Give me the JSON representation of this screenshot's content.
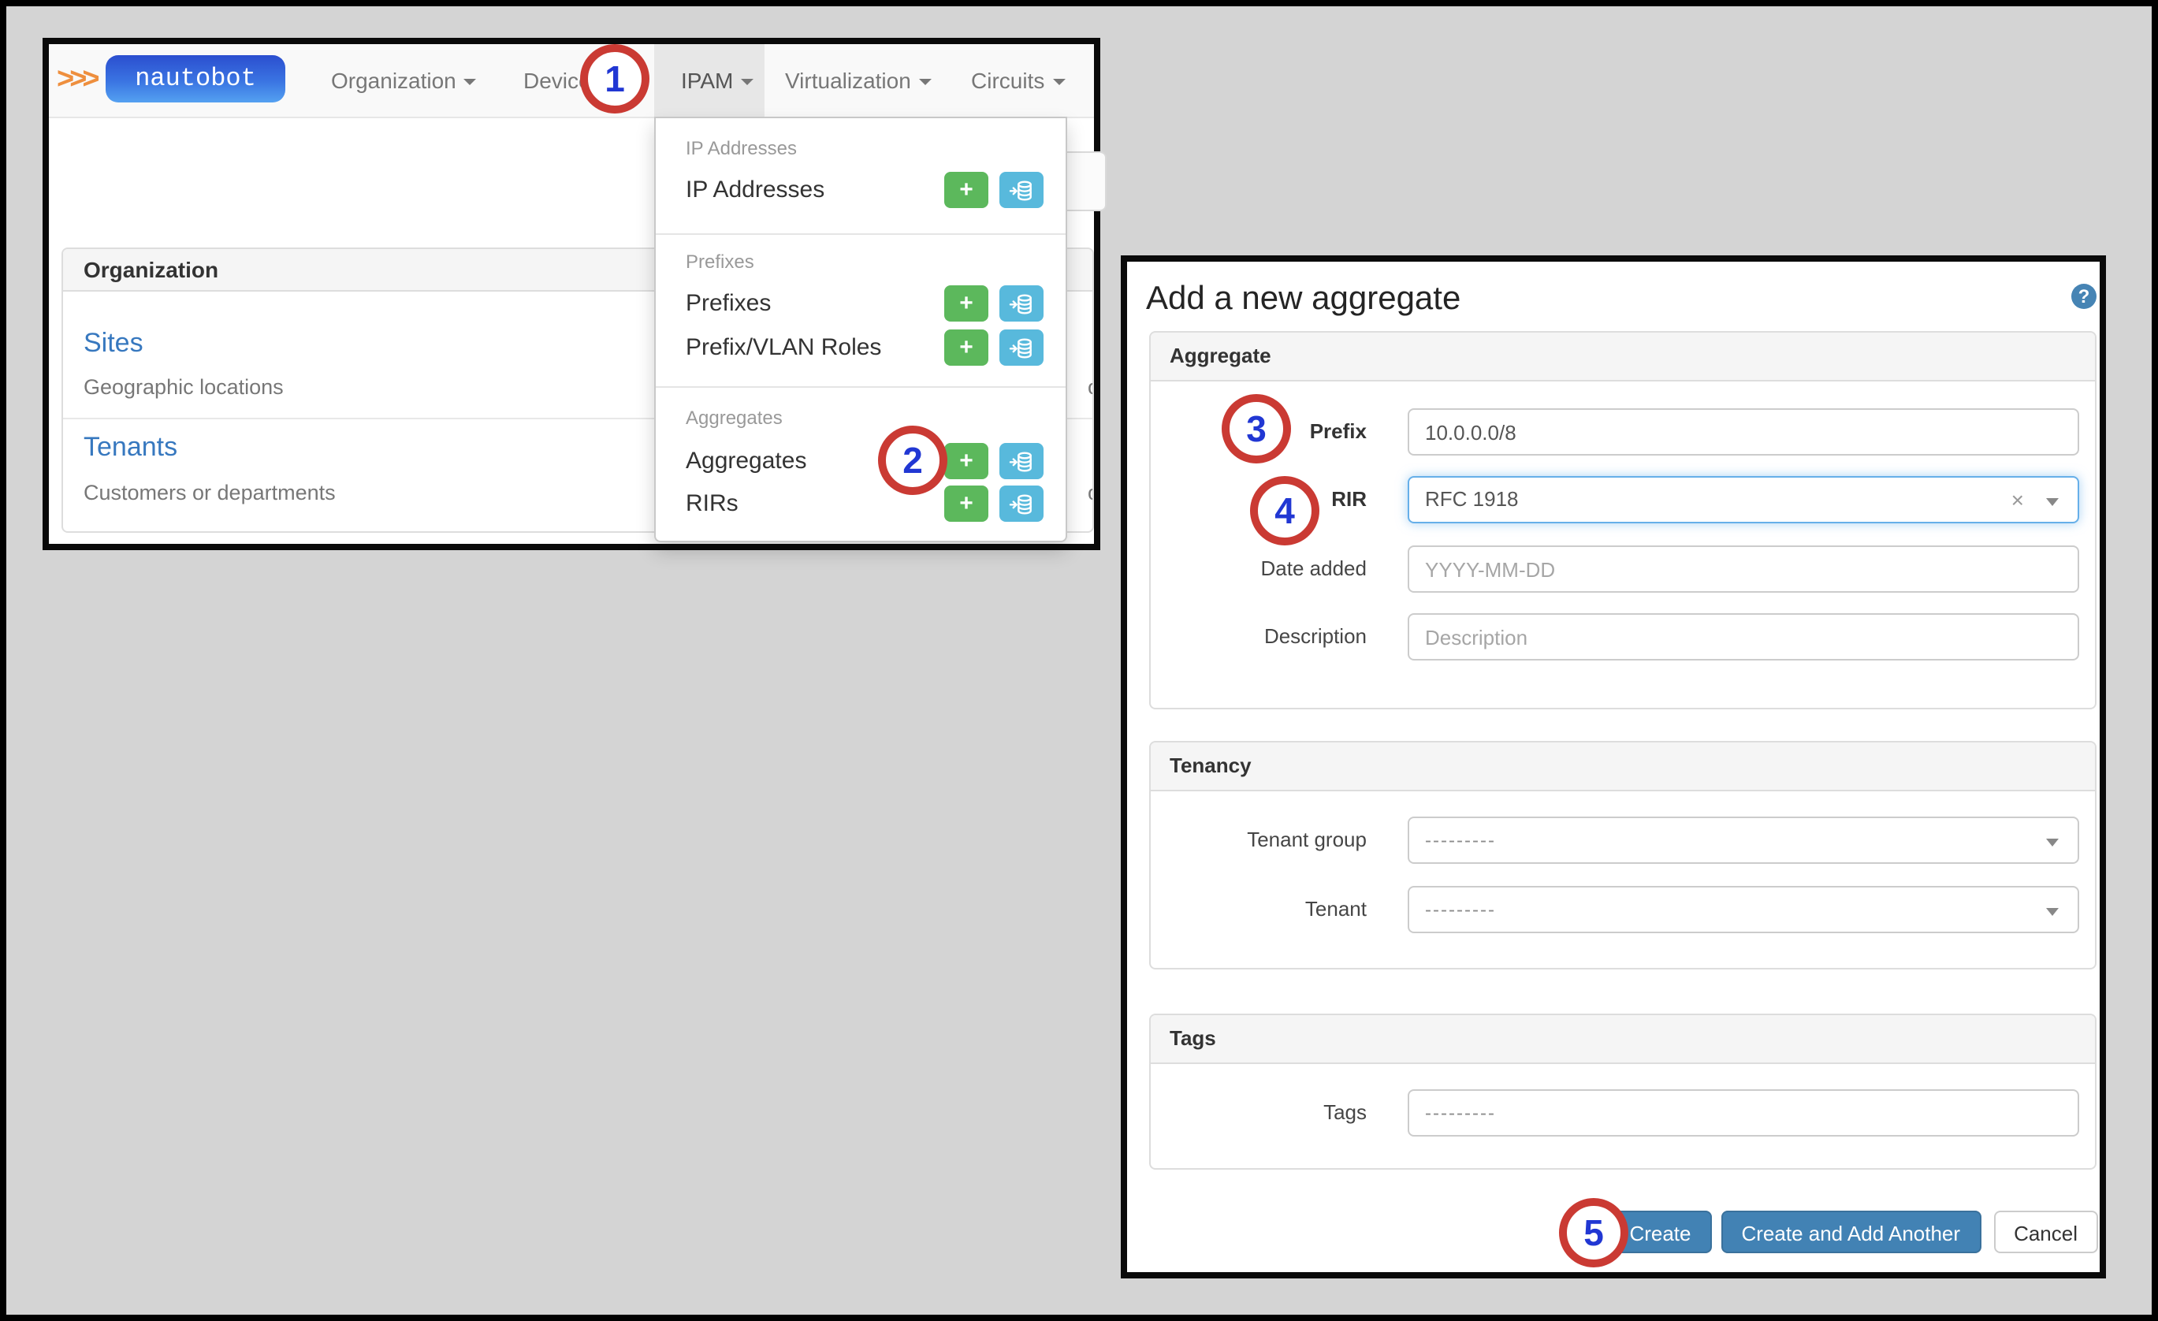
{
  "left_window": {
    "navbar": {
      "chevrons": ">>>",
      "logo_text": "nautobot",
      "items": [
        {
          "label": "Organization"
        },
        {
          "label": "Devices"
        },
        {
          "label": "IPAM"
        },
        {
          "label": "Virtualization"
        },
        {
          "label": "Circuits"
        }
      ]
    },
    "ipam_menu": {
      "add_label": "+",
      "import_icon": "database-import",
      "sections": [
        {
          "header": "IP Addresses",
          "items": [
            {
              "label": "IP Addresses"
            }
          ]
        },
        {
          "header": "Prefixes",
          "items": [
            {
              "label": "Prefixes"
            },
            {
              "label": "Prefix/VLAN Roles"
            }
          ]
        },
        {
          "header": "Aggregates",
          "items": [
            {
              "label": "Aggregates"
            },
            {
              "label": "RIRs"
            }
          ]
        }
      ]
    },
    "organization_panel": {
      "title": "Organization",
      "rows": [
        {
          "link": "Sites",
          "description": "Geographic locations",
          "truncated_right_text": "or"
        },
        {
          "link": "Tenants",
          "description": "Customers or departments",
          "truncated_right_text": "on"
        }
      ]
    }
  },
  "right_window": {
    "title": "Add a new aggregate",
    "help_icon": "?",
    "aggregate": {
      "section_title": "Aggregate",
      "prefix_label": "Prefix",
      "prefix_value": "10.0.0.0/8",
      "rir_label": "RIR",
      "rir_value": "RFC 1918",
      "rir_clear_icon": "×",
      "date_label": "Date added",
      "date_placeholder": "YYYY-MM-DD",
      "description_label": "Description",
      "description_placeholder": "Description"
    },
    "tenancy": {
      "section_title": "Tenancy",
      "tenant_group_label": "Tenant group",
      "tenant_group_value": "---------",
      "tenant_label": "Tenant",
      "tenant_value": "---------"
    },
    "tags": {
      "section_title": "Tags",
      "tags_label": "Tags",
      "tags_value": "---------"
    },
    "footer": {
      "create_label": "Create",
      "create_add_label": "Create and Add Another",
      "cancel_label": "Cancel"
    }
  },
  "step_badges": {
    "b1": "1",
    "b2": "2",
    "b3": "3",
    "b4": "4",
    "b5": "5"
  },
  "colors": {
    "accent_link_blue": "#3778bf",
    "button_blue": "#4282b4",
    "add_green": "#5cb85c",
    "import_blue": "#58b9dc",
    "badge_ring_red": "#ca3a33",
    "badge_number_blue": "#2137d3",
    "focus_border_blue": "#66afe9",
    "logo_orange": "#ee8f3e"
  }
}
